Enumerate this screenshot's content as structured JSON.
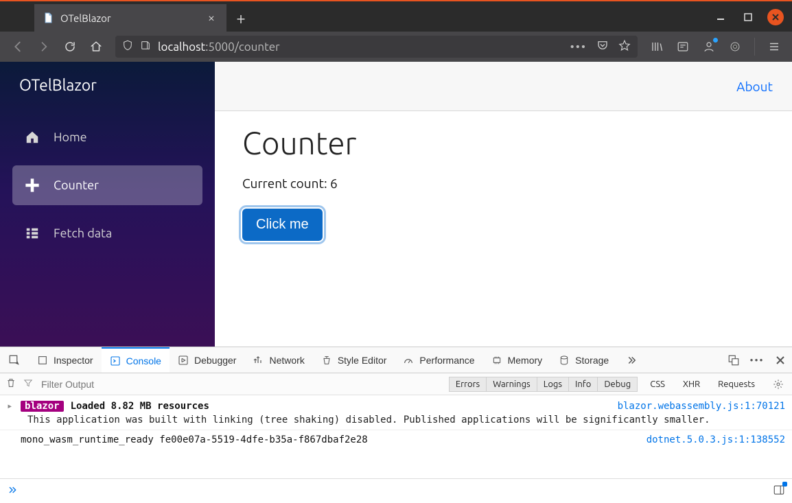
{
  "browser": {
    "tab_title": "OTelBlazor",
    "url_host": "localhost",
    "url_port_path": ":5000/counter"
  },
  "app": {
    "brand": "OTelBlazor",
    "nav": {
      "home": "Home",
      "counter": "Counter",
      "fetch": "Fetch data"
    },
    "about": "About",
    "page": {
      "title": "Counter",
      "count_label": "Current count: ",
      "count_value": "6",
      "button": "Click me"
    }
  },
  "devtools": {
    "tabs": {
      "inspector": "Inspector",
      "console": "Console",
      "debugger": "Debugger",
      "network": "Network",
      "style": "Style Editor",
      "performance": "Performance",
      "memory": "Memory",
      "storage": "Storage"
    },
    "filter_placeholder": "Filter Output",
    "toggles": {
      "errors": "Errors",
      "warnings": "Warnings",
      "logs": "Logs",
      "info": "Info",
      "debug": "Debug"
    },
    "chips": {
      "css": "CSS",
      "xhr": "XHR",
      "requests": "Requests"
    },
    "log1": {
      "badge": "blazor",
      "msg": "Loaded 8.82 MB resources",
      "sub": "This application was built with linking (tree shaking) disabled. Published applications will be significantly smaller.",
      "src": "blazor.webassembly.js:1:70121"
    },
    "log2": {
      "msg": "mono_wasm_runtime_ready fe00e07a-5519-4dfe-b35a-f867dbaf2e28",
      "src": "dotnet.5.0.3.js:1:138552"
    }
  }
}
